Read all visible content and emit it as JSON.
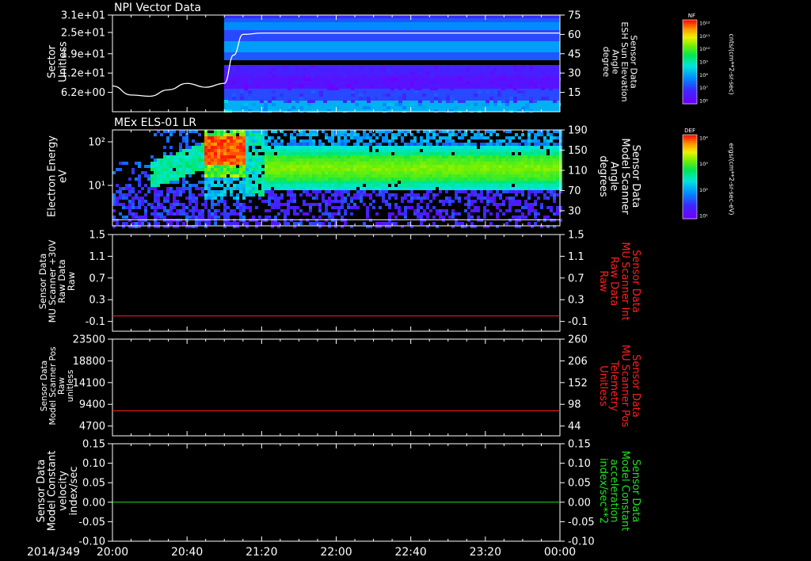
{
  "colors": {
    "background": "#000000",
    "axis": "#ffffff",
    "red_trace": "#ff2020",
    "green_trace": "#20e020"
  },
  "footer": {
    "date": "2014/349",
    "time_ticks": [
      "20:00",
      "20:40",
      "21:20",
      "22:00",
      "22:40",
      "23:20",
      "00:00"
    ]
  },
  "colorbars": [
    {
      "label": "NF",
      "ticks": [
        "10¹²",
        "10¹¹",
        "10¹⁰",
        "10⁹",
        "10⁸",
        "10⁷",
        "10⁶"
      ],
      "unit": "cnts/(cm**2-sr-sec)"
    },
    {
      "label": "DEF",
      "ticks": [
        "10⁴",
        "10³",
        "10²",
        "10¹"
      ],
      "unit": "ergs/(cm**2-sr-sec-eV)"
    }
  ],
  "chart_data": [
    {
      "type": "heatmap",
      "title": "NPI Vector Data",
      "ylabel": [
        "Sector",
        "Unitless"
      ],
      "y_ticks": [
        "3.1e+01",
        "2.5e+01",
        "1.9e+01",
        "1.2e+01",
        "6.2e+00"
      ],
      "y2label": [
        "Sensor Data",
        "ESH Sun Elevation",
        "Angle",
        "degree"
      ],
      "y2_ticks": [
        "75",
        "60",
        "45",
        "30",
        "15"
      ],
      "y2lim": [
        0,
        75
      ],
      "overlay_line": {
        "x": [
          "20:00",
          "20:10",
          "20:20",
          "20:30",
          "20:40",
          "20:50",
          "21:00",
          "21:05",
          "21:10",
          "21:20",
          "22:00",
          "23:00",
          "00:00"
        ],
        "y": [
          20,
          13,
          12,
          17,
          22,
          19,
          22,
          44,
          60,
          61,
          61,
          61,
          61
        ]
      }
    },
    {
      "type": "heatmap",
      "title": "MEx ELS-01 LR",
      "ylabel": [
        "Electron Energy",
        "eV"
      ],
      "y_ticks": [
        "10²",
        "10¹"
      ],
      "y2label": [
        "Sensor Data",
        "Model Scanner",
        "Angle",
        "degrees"
      ],
      "y2_ticks": [
        "190",
        "150",
        "110",
        "70",
        "30"
      ],
      "y2lim": [
        0,
        190
      ],
      "overlay_line": {
        "x": [
          "20:00",
          "00:00"
        ],
        "y": [
          12,
          12
        ]
      }
    },
    {
      "type": "line",
      "ylabel": [
        "Sensor Data",
        "MU Scanner +30V",
        "Raw Data",
        "Raw"
      ],
      "y_ticks": [
        "1.5",
        "1.1",
        "0.7",
        "0.3",
        "-0.1"
      ],
      "ylim": [
        -0.3,
        1.5
      ],
      "y2label": [
        "Sensor Data",
        "MU Scanner Int",
        "Raw Data",
        "Raw"
      ],
      "y2_ticks": [
        "1.5",
        "1.1",
        "0.7",
        "0.3",
        "-0.1"
      ],
      "series": [
        {
          "x": [
            "20:00",
            "00:00"
          ],
          "values": [
            0.0,
            0.0
          ]
        }
      ]
    },
    {
      "type": "line",
      "ylabel": [
        "Sensor Data",
        "Model Scanner Pos",
        "Raw",
        "unitless"
      ],
      "y_ticks": [
        "23500",
        "18800",
        "14100",
        "9400",
        "4700"
      ],
      "ylim": [
        0,
        23500
      ],
      "y2label": [
        "Sensor Data",
        "MU Scanner Pos",
        "Telemetry",
        "Unitless"
      ],
      "y2_ticks": [
        "260",
        "206",
        "152",
        "98",
        "44"
      ],
      "series": [
        {
          "x": [
            "20:00",
            "00:00"
          ],
          "values": [
            7990,
            7990
          ]
        }
      ]
    },
    {
      "type": "line",
      "ylabel": [
        "Sensor Data",
        "Model Constant",
        "velocity",
        "index/sec"
      ],
      "y_ticks": [
        "0.15",
        "0.10",
        "0.05",
        "0.00",
        "-0.05",
        "-0.10"
      ],
      "ylim": [
        -0.1,
        0.15
      ],
      "y2label": [
        "Sensor Data",
        "Model Constant",
        "acceleration",
        "index/sec**2"
      ],
      "y2_ticks": [
        "0.15",
        "0.10",
        "0.05",
        "0.00",
        "-0.05",
        "-0.10"
      ],
      "series": [
        {
          "x": [
            "20:00",
            "00:00"
          ],
          "values": [
            0.0,
            0.0
          ]
        }
      ]
    }
  ]
}
